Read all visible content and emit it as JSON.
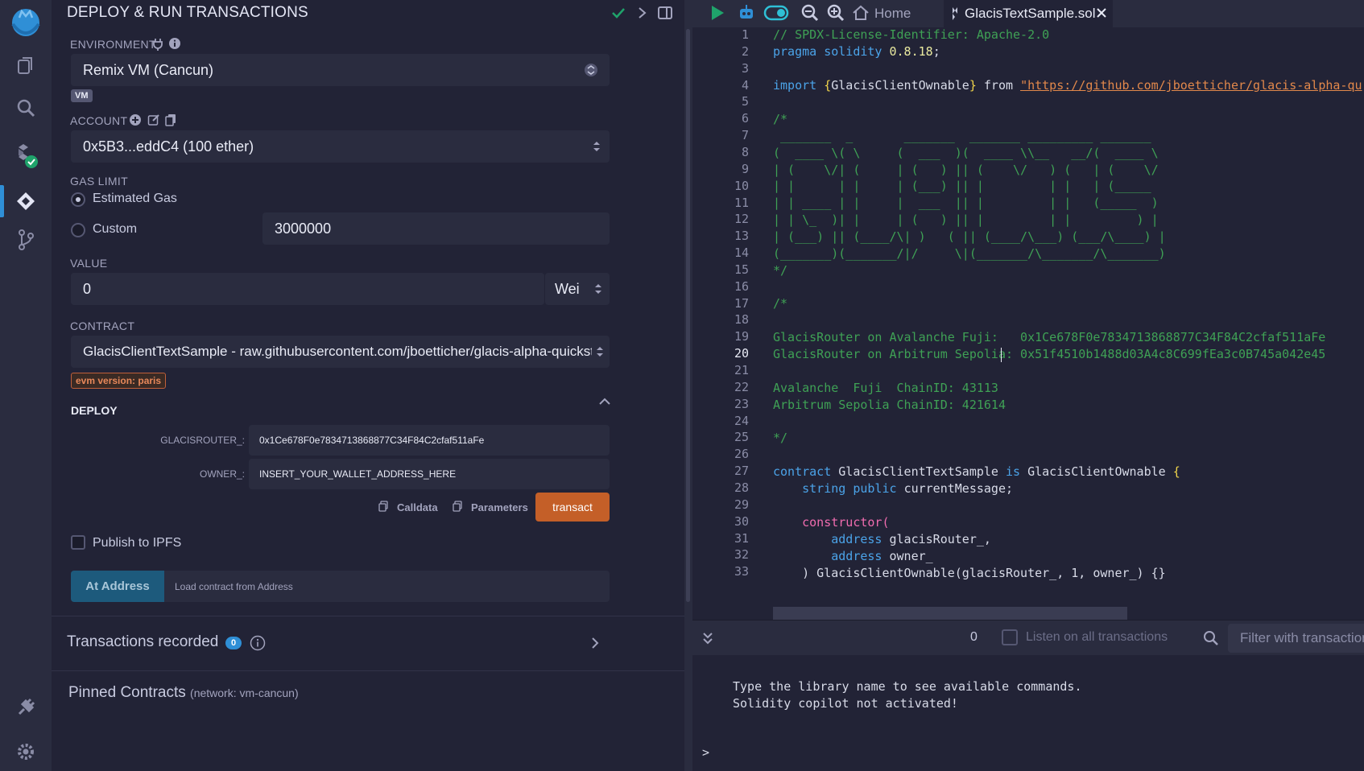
{
  "panel": {
    "title": "DEPLOY & RUN TRANSACTIONS",
    "environment_label": "ENVIRONMENT",
    "environment_value": "Remix VM (Cancun)",
    "vm_badge": "VM",
    "account_label": "ACCOUNT",
    "account_value": "0x5B3...eddC4 (100 ether)",
    "gas_limit_label": "GAS LIMIT",
    "gas_estimated_label": "Estimated Gas",
    "gas_custom_label": "Custom",
    "gas_custom_value": "3000000",
    "value_label": "VALUE",
    "value_amount": "0",
    "value_unit": "Wei",
    "contract_label": "CONTRACT",
    "contract_value": "GlacisClientTextSample - raw.githubusercontent.com/jboetticher/glacis-alpha-quickstart/",
    "evm_badge": "evm version: paris",
    "deploy_label": "DEPLOY",
    "param1_label": "GLACISROUTER_:",
    "param1_value": "0x1Ce678F0e7834713868877C34F84C2cfaf511aFe",
    "param2_label": "OWNER_:",
    "param2_value": "INSERT_YOUR_WALLET_ADDRESS_HERE",
    "calldata_label": "Calldata",
    "parameters_label": "Parameters",
    "transact_label": "transact",
    "publish_label": "Publish to IPFS",
    "at_address_label": "At Address",
    "at_address_placeholder": "Load contract from Address",
    "transactions_label": "Transactions recorded",
    "transactions_count": "0",
    "pinned_label": "Pinned Contracts",
    "pinned_network": "(network: vm-cancun)"
  },
  "tabs": {
    "home_label": "Home",
    "file_label": "GlacisTextSample.sol"
  },
  "editor": {
    "line_numbers": [
      "1",
      "2",
      "3",
      "4",
      "5",
      "6",
      "7",
      "8",
      "9",
      "10",
      "11",
      "12",
      "13",
      "14",
      "15",
      "16",
      "17",
      "18",
      "19",
      "20",
      "21",
      "22",
      "23",
      "24",
      "25",
      "26",
      "27",
      "28",
      "29",
      "30",
      "31",
      "32",
      "33"
    ],
    "active_line": "20",
    "l1": "// SPDX-License-Identifier: Apache-2.0",
    "l2_kw": "pragma solidity",
    "l2_ver": "0.8.18",
    "l4_kw": "import",
    "l4_name": "GlacisClientOwnable",
    "l4_from": "from",
    "l4_url": "\"https://github.com/jboetticher/glacis-alpha-qu",
    "ascii": [
      "/*",
      " _______  _       _______  _______ _________ _______",
      "(  ____ \\( \\     (  ___  )(  ____ \\\\__   __/(  ____ \\",
      "| (    \\/| (     | (   ) || (    \\/   ) (   | (    \\/",
      "| |      | |     | (___) || |         | |   | (_____",
      "| | ____ | |     |  ___  || |         | |   (_____  )",
      "| | \\_  )| |     | (   ) || |         | |         ) |",
      "| (___) || (____/\\| )   ( || (____/\\___) (___/\\____) |",
      "(_______)(_______/|/     \\|(_______/\\_______/\\_______)",
      "*/"
    ],
    "l17": "/*",
    "l19": "GlacisRouter on Avalanche Fuji:   0x1Ce678F0e7834713868877C34F84C2cfaf511aFe",
    "l20": "GlacisRouter on Arbitrum Sepolia: 0x51f4510b1488d03A4c8C699fEa3c0B745a042e45",
    "l22": "Avalanche  Fuji  ChainID: 43113",
    "l23": "Arbitrum Sepolia ChainID: 421614",
    "l25": "*/",
    "l27_kw": "contract",
    "l27_name": "GlacisClientTextSample",
    "l27_is": "is",
    "l27_base": "GlacisClientOwnable",
    "l28_type": "string public",
    "l28_name": "currentMessage;",
    "l30": "constructor(",
    "l31_kw": "address",
    "l31_name": "glacisRouter_,",
    "l32_kw": "address",
    "l32_name": "owner_",
    "l33": ") GlacisClientOwnable(glacisRouter_, 1, owner_) {}"
  },
  "terminal": {
    "pending_count": "0",
    "listen_label": "Listen on all transactions",
    "filter_placeholder": "Filter with transaction hash or address",
    "line1": "Type the library name to see available commands.",
    "line2": "Solidity copilot not activated!",
    "prompt": ">"
  }
}
